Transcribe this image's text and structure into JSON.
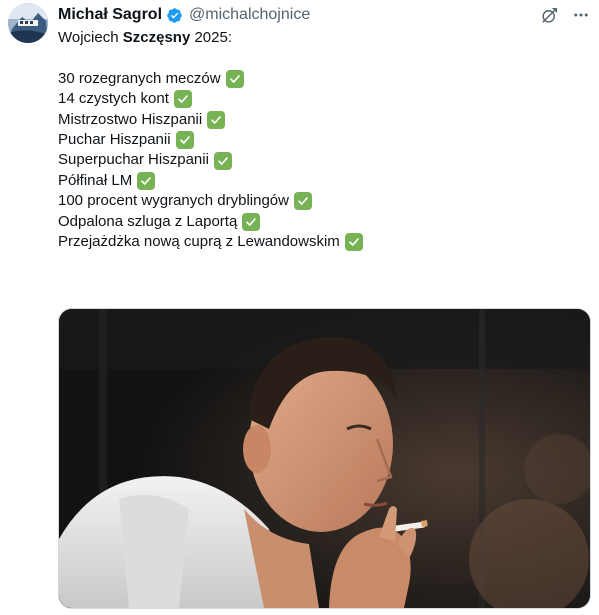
{
  "author": {
    "display_name": "Michał Sagrol",
    "handle": "@michalchojnice",
    "verified": true,
    "verified_color": "#1d9bf0",
    "avatar_icon": "avatar-photo"
  },
  "actions": {
    "grok_icon": "grok-icon",
    "more_icon": "more-icon"
  },
  "tweet": {
    "intro_prefix": "Wojciech ",
    "intro_bold": "Szczęsny",
    "intro_suffix": " 2025:",
    "check_color": "#77b255",
    "items": [
      "30 rozegranych meczów",
      "14 czystych kont",
      "Mistrzostwo Hiszpanii",
      "Puchar Hiszpanii",
      "Superpuchar Hiszpanii",
      "Półfinał LM",
      "100 procent wygranych dryblingów",
      "Odpalona szluga z Laportą",
      "Przejażdżka nową cuprą z Lewandowskim"
    ]
  },
  "media": {
    "type": "photo",
    "subject": "man-smoking-cigarette"
  }
}
